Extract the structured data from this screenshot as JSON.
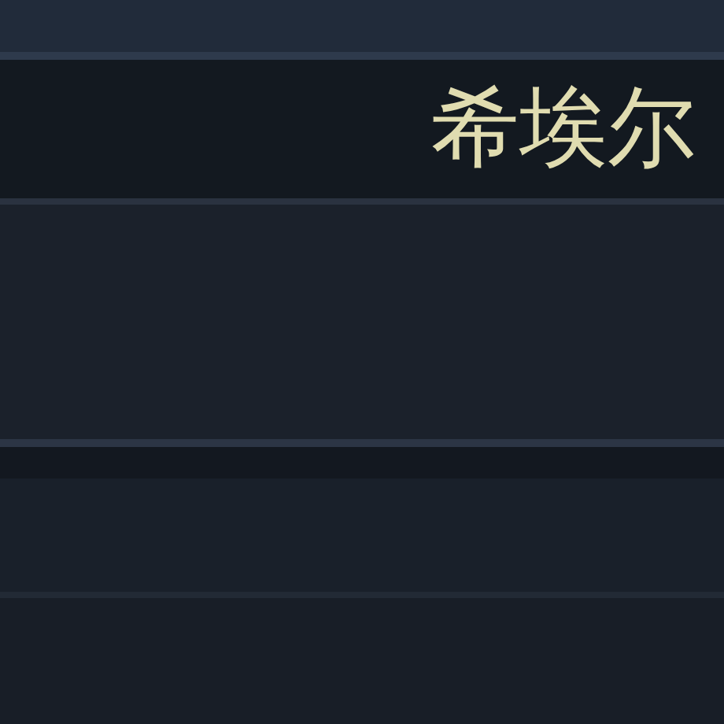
{
  "name_bar": {
    "name": "希埃尔"
  }
}
